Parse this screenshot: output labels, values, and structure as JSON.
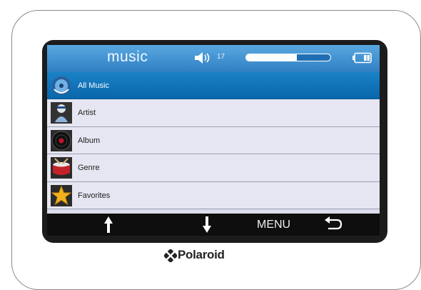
{
  "header": {
    "title": "music",
    "volume_icon": "speaker-icon",
    "volume_level": "17",
    "progress": 0.6,
    "battery_icon": "battery-icon"
  },
  "menu": {
    "items": [
      {
        "label": "All Music",
        "icon": "all-music-icon",
        "selected": true
      },
      {
        "label": "Artist",
        "icon": "artist-icon",
        "selected": false
      },
      {
        "label": "Album",
        "icon": "album-icon",
        "selected": false
      },
      {
        "label": "Genre",
        "icon": "genre-icon",
        "selected": false
      },
      {
        "label": "Favorites",
        "icon": "star-icon",
        "selected": false
      }
    ]
  },
  "bottom": {
    "up_icon": "arrow-up-icon",
    "down_icon": "arrow-down-icon",
    "menu_label": "MENU",
    "back_icon": "back-icon"
  },
  "brand": {
    "name": "Polaroid"
  },
  "colors": {
    "header_top": "#5aa8e0",
    "header_bottom": "#2f7fc3",
    "selected_row": "#0a66aa",
    "row_bg": "#e6e6f2",
    "bottom_bar": "#0e0e0e"
  }
}
